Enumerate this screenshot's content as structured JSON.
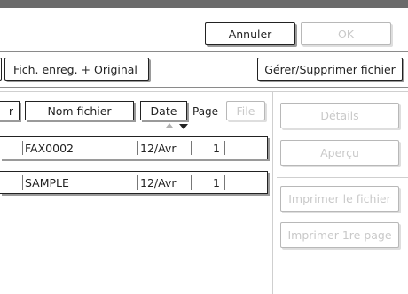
{
  "header": {
    "cancel_label": "Annuler",
    "ok_label": "OK"
  },
  "toolbar": {
    "tab_label": "Fich. enreg. + Original",
    "manage_label": "Gérer/Supprimer fichier"
  },
  "table": {
    "partial_header": "r",
    "columns": [
      "Nom fichier",
      "Date",
      "Page",
      "File"
    ],
    "rows": [
      {
        "name": "FAX0002",
        "date": "12/Avr",
        "pages": "1"
      },
      {
        "name": "SAMPLE",
        "date": "12/Avr",
        "pages": "1"
      }
    ]
  },
  "side": {
    "details": "Détails",
    "preview": "Aperçu",
    "print_file": "Imprimer le fichier",
    "print_first": "Imprimer 1re page"
  }
}
